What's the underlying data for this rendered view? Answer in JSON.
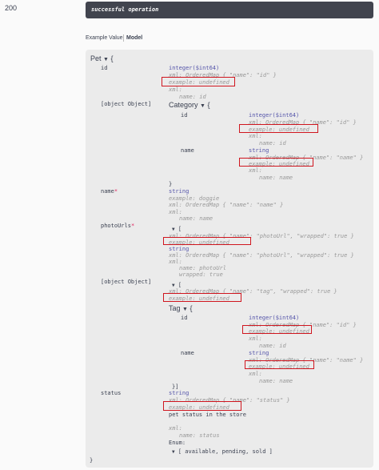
{
  "response": {
    "code": "200",
    "description": "successful operation"
  },
  "tabs": {
    "example_value": "Example Value",
    "model": "Model"
  },
  "model": {
    "pet_title": "Pet",
    "pet_open": "{",
    "pet_close": "}",
    "properties": {
      "id": {
        "name": "id",
        "type": "integer($int64)",
        "xml": "xml: OrderedMap { \"name\": \"id\" }",
        "example": "example: undefined",
        "xml_label": "xml:",
        "xml_name": "name: id"
      },
      "category": {
        "name": {
          "name": "name",
          "type": "string",
          "xml": "xml: OrderedMap { \"name\": \"name\" }",
          "example": "example: undefined",
          "xml_label": "xml:",
          "xml_name": "name: name"
        },
        "title": "Category",
        "open": "{",
        "close": "}",
        "id": {
          "name": "id",
          "type": "integer($int64)",
          "xml": "xml: OrderedMap { \"name\": \"id\" }",
          "example": "example: undefined",
          "xml_label": "xml:",
          "xml_name": "name: id"
        }
      },
      "name": {
        "name": "name",
        "required": "*",
        "type": "string",
        "example": "example: doggie",
        "xml": "xml: OrderedMap { \"name\": \"name\" }",
        "xml_label": "xml:",
        "xml_name": "name: name"
      },
      "photoUrls": {
        "name": "photoUrls",
        "required": "*",
        "open": "[",
        "xml": "xml: OrderedMap { \"name\": \"photoUrl\", \"wrapped\": true }",
        "example": "example: undefined",
        "item_type": "string",
        "item_xml": "xml: OrderedMap { \"name\": \"photoUrl\", \"wrapped\": true }",
        "xml_label": "xml:",
        "xml_name": "name: photoUrl",
        "xml_wrapped": "wrapped: true"
      },
      "tags": {
        "name": {
          "name": "name",
          "type": "string",
          "xml": "xml: OrderedMap { \"name\": \"name\" }",
          "example": "example: undefined",
          "xml_label": "xml:",
          "xml_name": "name: name"
        },
        "open": "[",
        "xml": "xml: OrderedMap { \"name\": \"tag\", \"wrapped\": true }",
        "example": "example: undefined",
        "title": "Tag",
        "obj_open": "{",
        "id": {
          "name": "id",
          "type": "integer($int64)",
          "xml": "xml: OrderedMap { \"name\": \"id\" }",
          "example": "example: undefined",
          "xml_label": "xml:",
          "xml_name": "name: id"
        },
        "close": "}]"
      },
      "status": {
        "name": "status",
        "type": "string",
        "xml": "xml: OrderedMap { \"name\": \"status\" }",
        "example": "example: undefined",
        "description": "pet status in the store",
        "xml_label": "xml:",
        "xml_name": "name: status",
        "enum_label": "Enum:",
        "enum_values": "[ available, pending, sold ]"
      }
    }
  },
  "highlight_color": "#d0161f"
}
